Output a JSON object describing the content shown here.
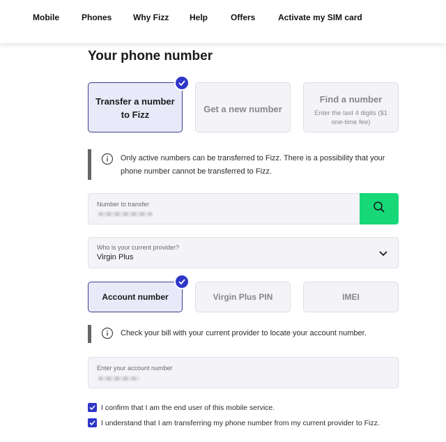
{
  "nav": {
    "items": [
      "Mobile",
      "Phones",
      "Why Fizz",
      "Help",
      "Offers",
      "Activate my SIM card"
    ]
  },
  "page_title": "Your phone number",
  "options": [
    {
      "label": "Transfer a number to Fizz",
      "selected": true
    },
    {
      "label": "Get a new number",
      "selected": false
    },
    {
      "label": "Find a number",
      "sublabel": "Enter the last 4 digits ($1 one-time fee)",
      "selected": false
    }
  ],
  "info_transfer": "Only active numbers can be transferred to Fizz. There is a possibility that your phone number cannot be transferred to Fizz.",
  "number_field": {
    "label": "Number to transfer"
  },
  "provider_field": {
    "label": "Who is your current provider?",
    "value": "Virgin Plus"
  },
  "id_tabs": [
    {
      "label": "Account number",
      "selected": true
    },
    {
      "label": "Virgin Plus PIN",
      "selected": false
    },
    {
      "label": "IMEI",
      "selected": false
    }
  ],
  "info_account": "Check your bill with your current provider to locate your account number.",
  "account_field": {
    "label": "Enter your account number"
  },
  "confirmations": [
    {
      "text": "I confirm that I am the end user of this mobile service.",
      "checked": true
    },
    {
      "text": "I understand that I am transferring my phone number from my current provider to Fizz.",
      "checked": true
    }
  ],
  "colors": {
    "accent": "#2e36c9",
    "search_button": "#16d877",
    "selected_bg": "#e8eaf9"
  }
}
